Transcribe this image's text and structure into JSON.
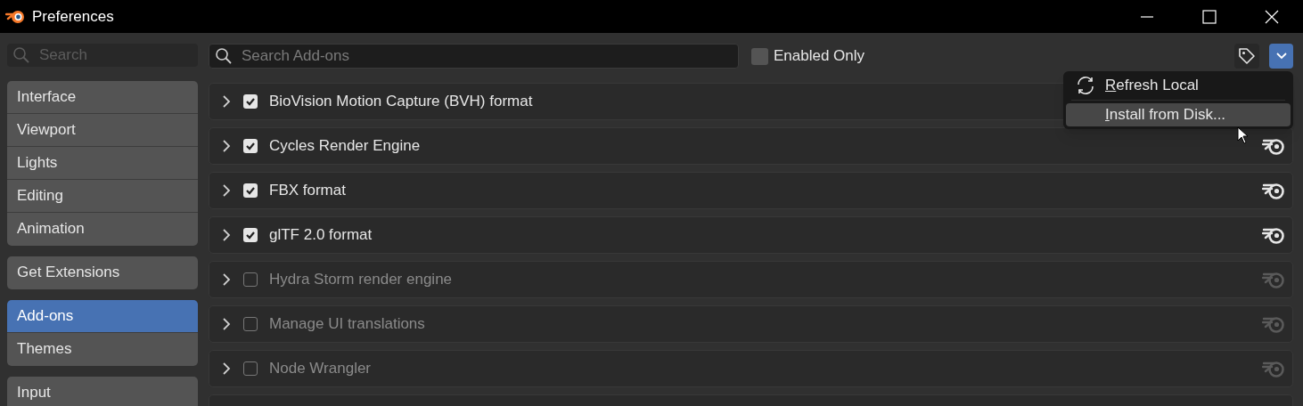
{
  "window": {
    "title": "Preferences"
  },
  "sidebar": {
    "search": {
      "placeholder": "Search"
    },
    "groups": [
      {
        "items": [
          {
            "label": "Interface",
            "selected": false
          },
          {
            "label": "Viewport",
            "selected": false
          },
          {
            "label": "Lights",
            "selected": false
          },
          {
            "label": "Editing",
            "selected": false
          },
          {
            "label": "Animation",
            "selected": false
          }
        ]
      },
      {
        "items": [
          {
            "label": "Get Extensions",
            "selected": false
          }
        ]
      },
      {
        "items": [
          {
            "label": "Add-ons",
            "selected": true
          },
          {
            "label": "Themes",
            "selected": false
          }
        ]
      },
      {
        "items": [
          {
            "label": "Input",
            "selected": false
          }
        ]
      }
    ]
  },
  "toolbar": {
    "search": {
      "placeholder": "Search Add-ons"
    },
    "enabled_only": {
      "label": "Enabled Only",
      "checked": false
    },
    "menu_open": true
  },
  "menu": [
    {
      "label": "Refresh Local",
      "highlighted": false,
      "kind": "refresh"
    },
    {
      "label": "Install from Disk...",
      "highlighted": true,
      "kind": "plain"
    }
  ],
  "addons": [
    {
      "name": "BioVision Motion Capture (BVH) format",
      "enabled": true,
      "icon_covered": true
    },
    {
      "name": "Cycles Render Engine",
      "enabled": true
    },
    {
      "name": "FBX format",
      "enabled": true
    },
    {
      "name": "glTF 2.0 format",
      "enabled": true
    },
    {
      "name": "Hydra Storm render engine",
      "enabled": false
    },
    {
      "name": "Manage UI translations",
      "enabled": false
    },
    {
      "name": "Node Wrangler",
      "enabled": false
    }
  ]
}
